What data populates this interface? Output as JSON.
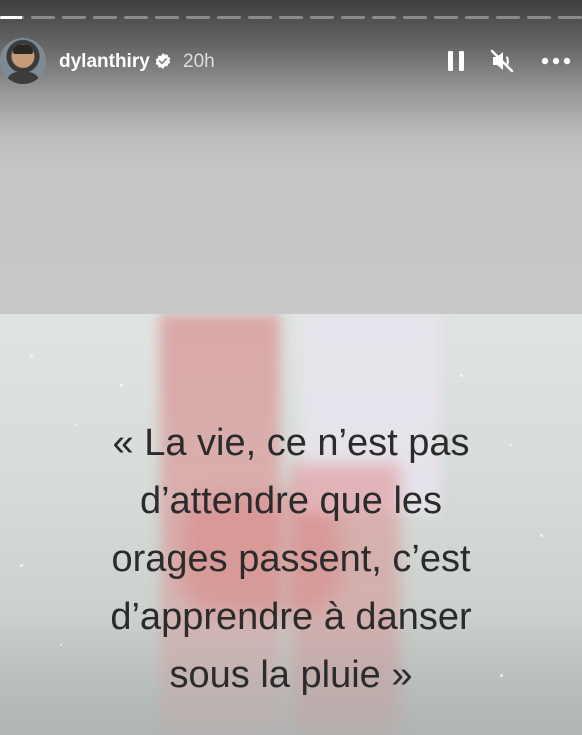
{
  "story": {
    "progress": {
      "segments": 19,
      "active_index": 0,
      "active_fraction": 0.9
    },
    "header": {
      "username": "dylanthiry",
      "verified_icon": "verified-badge-icon",
      "time_ago": "20h",
      "controls": {
        "pause_icon": "pause-icon",
        "mute_icon": "muted-speaker-icon",
        "more_icon": "more-options-icon"
      }
    },
    "quote": {
      "lines": [
        "« La vie, ce n’est pas",
        "d’attendre que les",
        "orages passent, c’est",
        "d’apprendre à danser",
        "sous la pluie »"
      ]
    }
  }
}
